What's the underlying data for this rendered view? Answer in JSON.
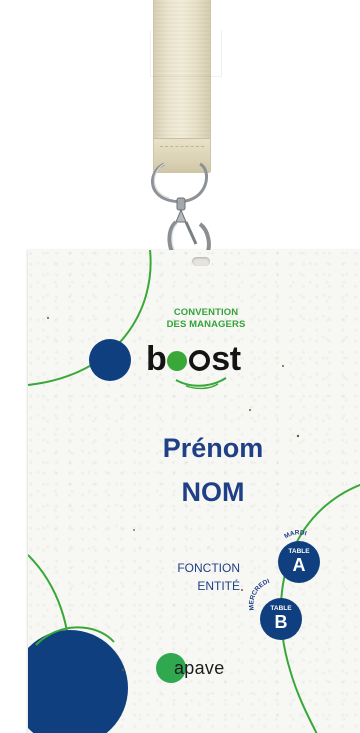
{
  "badge": {
    "event_line1": "CONVENTION",
    "event_line2": "DES MANAGERS",
    "brand_logo_text": "boost",
    "first_name": "Prénom",
    "last_name": "NOM",
    "fonction": "FONCTION",
    "entite": "ENTITÉ",
    "tables": [
      {
        "day": "MARDI",
        "label": "TABLE",
        "letter": "A"
      },
      {
        "day": "MERCREDI",
        "label": "TABLE",
        "letter": "B"
      }
    ],
    "sponsor_logo_text": "apave"
  },
  "colors": {
    "navy": "#1f3f86",
    "dark_blue_circle": "#0f3f7f",
    "green": "#35a33a",
    "lanyard": "#ece6d1",
    "paper": "#f7f7f4"
  },
  "icons": [
    "lanyard-strap",
    "lanyard-clip-icon",
    "badge-hole"
  ]
}
